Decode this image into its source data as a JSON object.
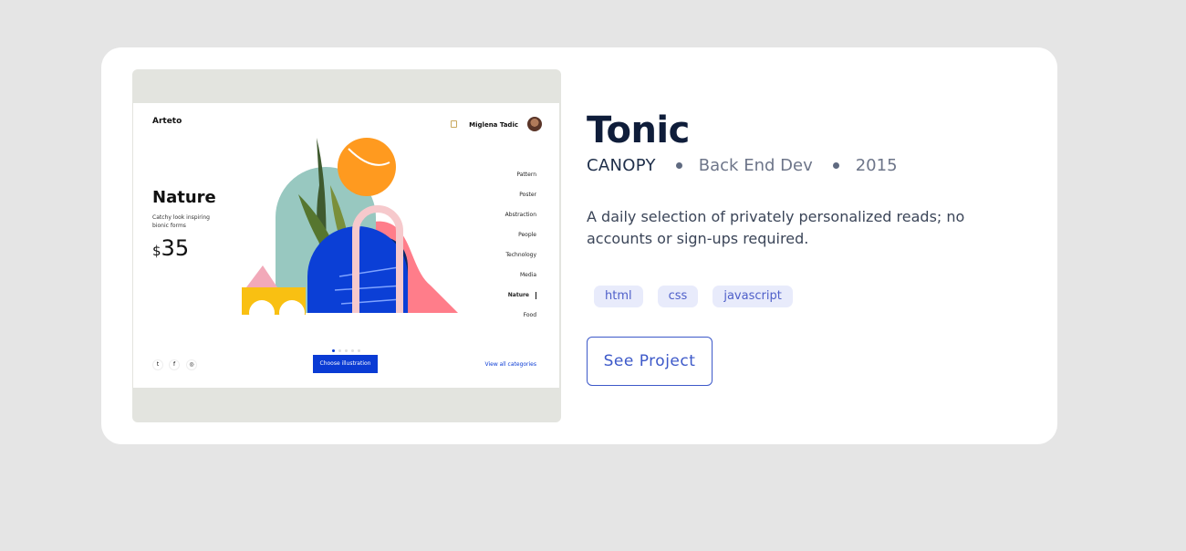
{
  "project": {
    "title": "Tonic",
    "client": "CANOPY",
    "role": "Back End Dev",
    "year": "2015",
    "description": "A daily selection of privately personalized reads; no accounts or sign-ups required.",
    "tags": [
      "html",
      "css",
      "javascript"
    ],
    "button_label": "See Project"
  },
  "preview": {
    "brand": "Arteto",
    "user_name": "Miglena Tadic",
    "heading": "Nature",
    "subtitle": "Catchy look inspiring bionic forms",
    "price_currency": "$",
    "price_value": "35",
    "categories": [
      "Pattern",
      "Poster",
      "Abstraction",
      "People",
      "Technology",
      "Media",
      "Nature",
      "Food"
    ],
    "active_category": "Nature",
    "cta_label": "Choose illustration",
    "view_all_label": "View all categories",
    "social_icons": [
      "twitter-icon",
      "facebook-icon",
      "instagram-icon"
    ]
  },
  "colors": {
    "page_bg": "#e5e5e5",
    "title": "#0f1d3a",
    "accent": "#3d59c9",
    "tag_bg": "#e8ebfb"
  }
}
